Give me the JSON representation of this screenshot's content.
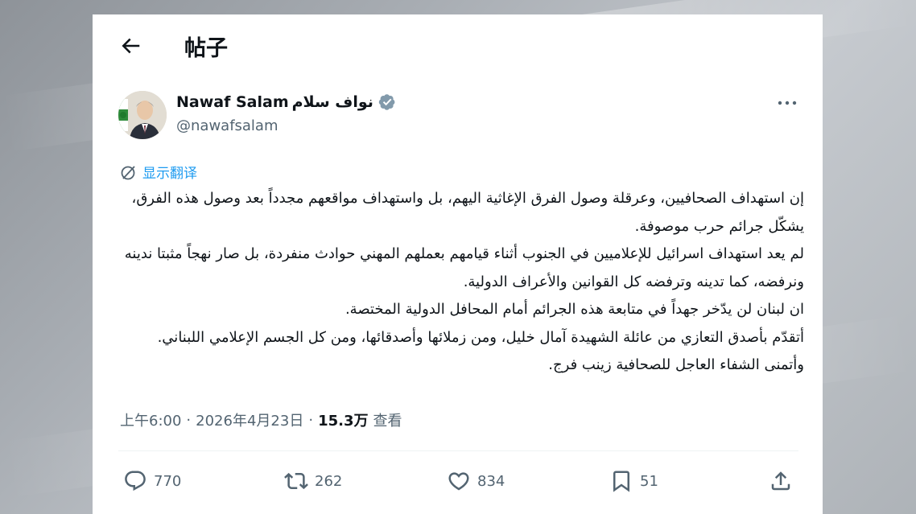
{
  "header": {
    "title": "帖子",
    "back_icon": "arrow-left-icon"
  },
  "author": {
    "name": "Nawaf Salam",
    "name_ar": "نواف سلام",
    "handle": "@nawafsalam",
    "verified_icon": "verified-badge-icon",
    "verified_color": "#536471"
  },
  "more_icon": "more-dots-icon",
  "translate": {
    "label": "显示翻译",
    "icon": "translate-icon",
    "color": "#1d9bf0"
  },
  "tweet": {
    "lines": [
      "إن استهداف الصحافيين، وعرقلة وصول الفرق الإغاثية اليهم، بل واستهداف مواقعهم مجدداً بعد وصول هذه الفرق، يشكّل جرائم حرب موصوفة.",
      "لم يعد  استهداف اسرائيل للإعلاميين في الجنوب أثناء قيامهم بعملهم المهني حوادث منفردة، بل صار نهجاً مثبتا ندينه ونرفضه، كما تدينه وترفضه كل القوانين والأعراف الدولية.",
      "ان لبنان لن يدّخر جهداً في متابعة هذه الجرائم أمام المحافل الدولية المختصة.",
      "أتقدّم بأصدق التعازي من عائلة الشهيدة آمال خليل، ومن زملائها وأصدقائها، ومن كل الجسم الإعلامي اللبناني. وأتمنى الشفاء العاجل للصحافية زينب فرج."
    ]
  },
  "meta": {
    "time": "上午6:00",
    "separator": "·",
    "date": "2026年4月23日",
    "views_count": "15.3万",
    "views_label": "查看"
  },
  "actions": {
    "reply": {
      "icon": "reply-icon",
      "count": "770"
    },
    "retweet": {
      "icon": "retweet-icon",
      "count": "262"
    },
    "like": {
      "icon": "heart-icon",
      "count": "834"
    },
    "bookmark": {
      "icon": "bookmark-icon",
      "count": "51"
    },
    "share": {
      "icon": "share-icon"
    }
  }
}
